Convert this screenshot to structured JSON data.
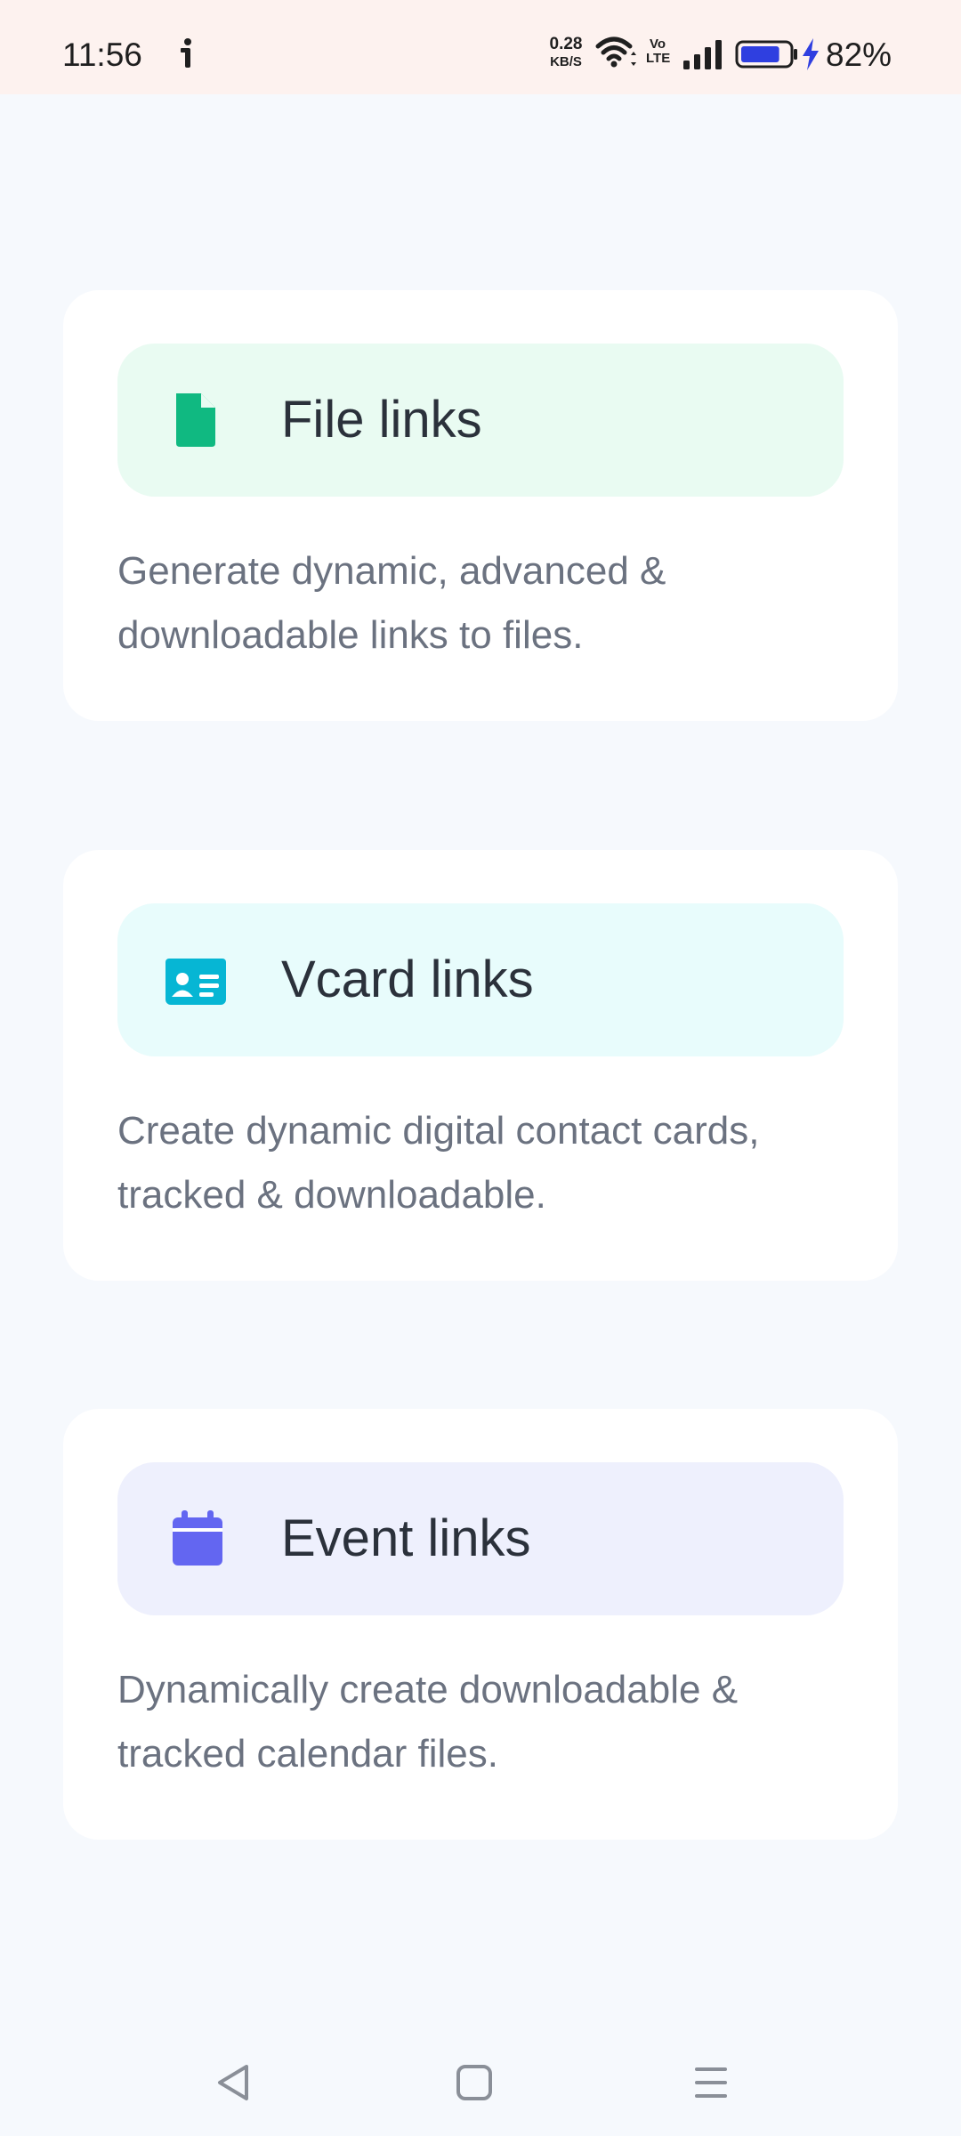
{
  "status_bar": {
    "time": "11:56",
    "net_speed_value": "0.28",
    "net_speed_unit": "KB/S",
    "volte_line1": "Vo",
    "volte_line2": "LTE",
    "battery_percent": "82%",
    "battery_level": 0.82,
    "icons": [
      "alert-icon",
      "wifi-icon",
      "volte-icon",
      "signal-icon",
      "battery-icon",
      "charging-icon"
    ]
  },
  "cards": [
    {
      "title": "File links",
      "description": "Generate dynamic, advanced & downloadable links to files.",
      "icon": "file-icon",
      "header_bg": "#e9fbf2",
      "icon_color": "#10b981"
    },
    {
      "title": "Vcard links",
      "description": "Create dynamic digital contact cards, tracked & downloadable.",
      "icon": "contact-card-icon",
      "header_bg": "#e8fcfc",
      "icon_color": "#06b6d4"
    },
    {
      "title": "Event links",
      "description": "Dynamically create downloadable & tracked calendar files.",
      "icon": "calendar-icon",
      "header_bg": "#eef0fd",
      "icon_color": "#6366f1"
    }
  ],
  "nav_bar": {
    "buttons": [
      "back-icon",
      "home-icon",
      "menu-icon"
    ]
  }
}
